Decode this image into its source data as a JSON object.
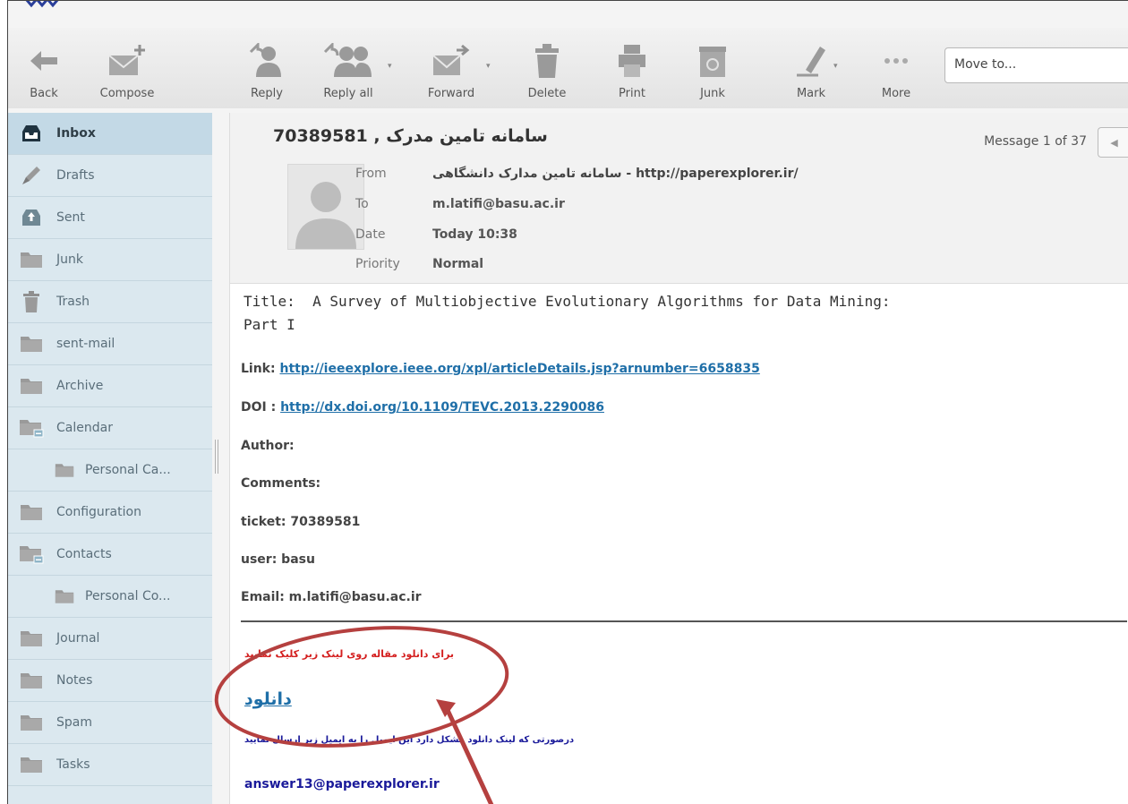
{
  "toolbar": {
    "back": "Back",
    "compose": "Compose",
    "reply": "Reply",
    "reply_all": "Reply all",
    "forward": "Forward",
    "delete": "Delete",
    "print": "Print",
    "junk": "Junk",
    "mark": "Mark",
    "more": "More",
    "move_to": "Move to..."
  },
  "folders": [
    {
      "label": "Inbox",
      "icon": "inbox-icon",
      "selected": true
    },
    {
      "label": "Drafts",
      "icon": "pencil-icon"
    },
    {
      "label": "Sent",
      "icon": "sent-icon"
    },
    {
      "label": "Junk",
      "icon": "folder-icon"
    },
    {
      "label": "Trash",
      "icon": "trash-icon"
    },
    {
      "label": "sent-mail",
      "icon": "folder-icon"
    },
    {
      "label": "Archive",
      "icon": "folder-icon"
    },
    {
      "label": "Calendar",
      "icon": "folder-collapse-icon"
    },
    {
      "label": "Personal Ca...",
      "icon": "folder-icon",
      "sub": true
    },
    {
      "label": "Configuration",
      "icon": "folder-icon"
    },
    {
      "label": "Contacts",
      "icon": "folder-collapse-icon"
    },
    {
      "label": "Personal Co...",
      "icon": "folder-icon",
      "sub": true
    },
    {
      "label": "Journal",
      "icon": "folder-icon"
    },
    {
      "label": "Notes",
      "icon": "folder-icon"
    },
    {
      "label": "Spam",
      "icon": "folder-icon"
    },
    {
      "label": "Tasks",
      "icon": "folder-icon"
    }
  ],
  "message": {
    "subject": "سامانه تامین مدرک , 70389581",
    "counter": "Message 1 of 37",
    "from_label": "From",
    "from_value": "سامانه تامین مدارک دانشگاهی - http://paperexplorer.ir/",
    "to_label": "To",
    "to_value": "m.latifi@basu.ac.ir",
    "date_label": "Date",
    "date_value": "Today 10:38",
    "priority_label": "Priority",
    "priority_value": "Normal"
  },
  "body": {
    "title_line": "Title:  A Survey of Multiobjective Evolutionary Algorithms for Data Mining:\nPart I",
    "link_label": "Link:",
    "link_url": "http://ieeexplore.ieee.org/xpl/articleDetails.jsp?arnumber=6658835",
    "doi_label": "DOI :",
    "doi_url": "http://dx.doi.org/10.1109/TEVC.2013.2290086",
    "author": "Author:",
    "comments": "Comments:",
    "ticket": "ticket: 70389581",
    "user": "user: basu",
    "email": "Email:  m.latifi@basu.ac.ir",
    "download_prompt": "برای دانلود مقاله روی لینک زیر کلیک نمایید",
    "download_link": "دانلود",
    "problem_note": "درصورتی که لینک دانلود مشکل دارد این ایمیل را به ایمیل زیر ارسال نمایید",
    "answer_email": "answer13@paperexplorer.ir"
  },
  "colors": {
    "sidebar_bg": "#dbe8ef",
    "link": "#1f6fa8",
    "annotation": "#b5403f",
    "red_text": "#d42020",
    "blue_text": "#1a1a9a"
  }
}
